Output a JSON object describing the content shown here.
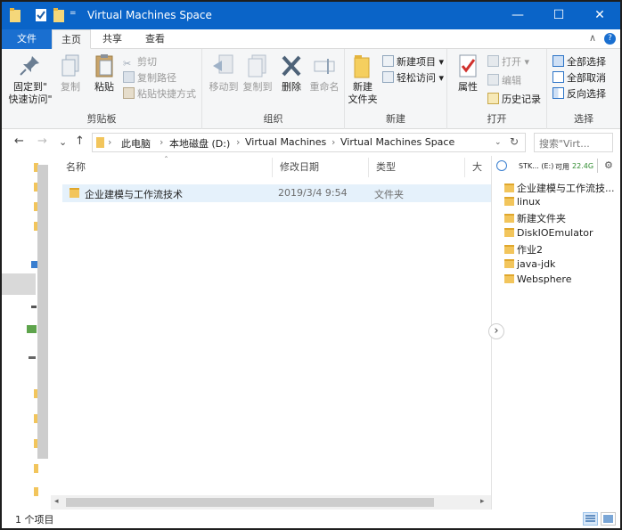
{
  "window": {
    "title": "Virtual Machines Space",
    "controls": {
      "minimize": "—",
      "maximize": "☐",
      "close": "✕"
    }
  },
  "tabs": {
    "file": "文件",
    "home": "主页",
    "share": "共享",
    "view": "查看",
    "collapse": "∧",
    "help": "?"
  },
  "ribbon": {
    "clipboard": {
      "label": "剪贴板",
      "pin_line1": "固定到\"",
      "pin_line2": "快速访问\"",
      "copy": "复制",
      "paste": "粘贴",
      "cut": "剪切",
      "copy_path": "复制路径",
      "paste_shortcut": "粘贴快捷方式"
    },
    "organize": {
      "label": "组织",
      "move_to": "移动到",
      "copy_to": "复制到",
      "delete": "删除",
      "rename": "重命名"
    },
    "new": {
      "label": "新建",
      "new_folder_line1": "新建",
      "new_folder_line2": "文件夹",
      "new_item": "新建项目 ▾",
      "easy_access": "轻松访问 ▾"
    },
    "open": {
      "label": "打开",
      "properties": "属性",
      "open": "打开 ▾",
      "edit": "编辑",
      "history": "历史记录"
    },
    "select": {
      "label": "选择",
      "select_all": "全部选择",
      "select_none": "全部取消",
      "invert": "反向选择"
    }
  },
  "nav": {
    "back": "←",
    "forward": "→",
    "recent": "⌄",
    "up": "↑",
    "breadcrumbs": [
      "此电脑",
      "本地磁盘 (D:)",
      "Virtual Machines",
      "Virtual Machines Space"
    ],
    "refresh": "↻",
    "search_placeholder": "搜索\"Virt..."
  },
  "list": {
    "columns": {
      "name": "名称",
      "date": "修改日期",
      "type": "类型",
      "size": "大小"
    },
    "rows": [
      {
        "name": "企业建模与工作流技术",
        "date": "2019/3/4 9:54",
        "type": "文件夹"
      }
    ]
  },
  "preview": {
    "drive": "STK... (E:)",
    "free_label": "可用",
    "free_size": "22.4G",
    "items": [
      "企业建模与工作流技...",
      "linux",
      "新建文件夹",
      "DiskIOEmulator",
      "作业2",
      "java-jdk",
      "Websphere"
    ],
    "expand": "›"
  },
  "status": {
    "count": "1 个项目"
  },
  "colors": {
    "titlebar": "#0a64c8",
    "selection": "#e5f1fb",
    "folder": "#f2c55c",
    "accent": "#1a6fd0"
  }
}
